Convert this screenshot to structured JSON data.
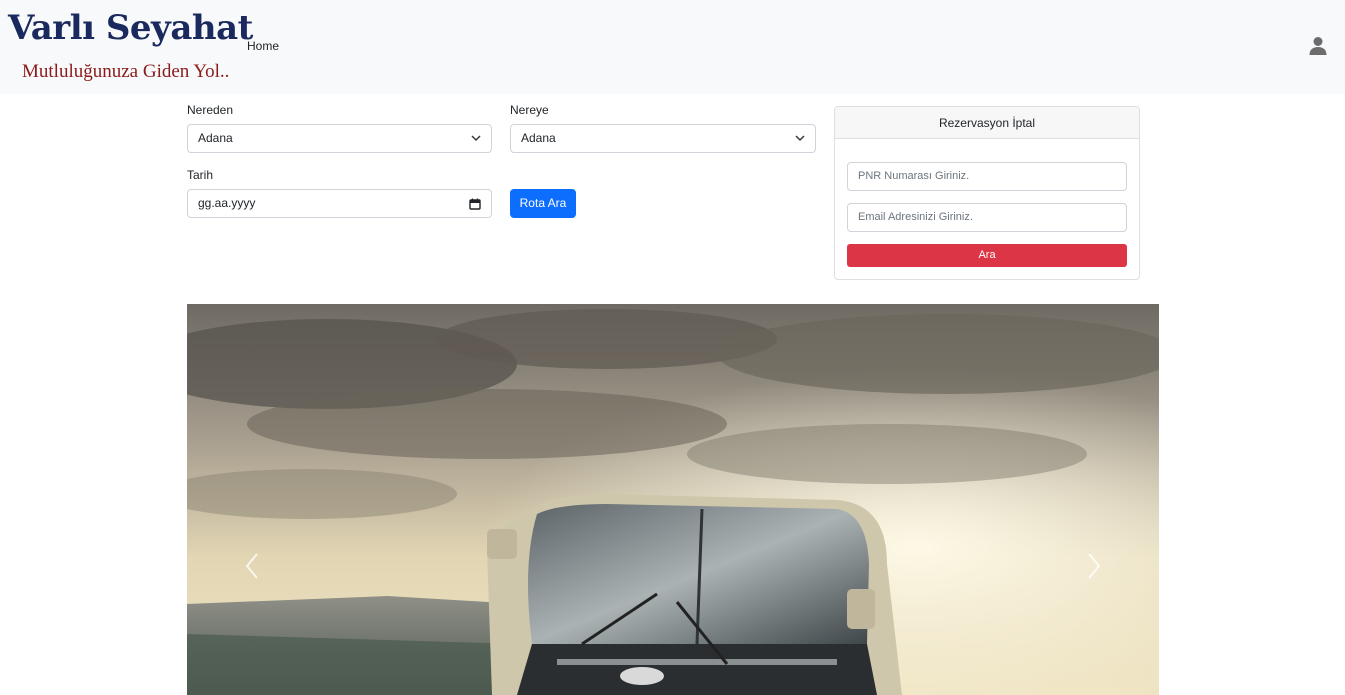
{
  "navbar": {
    "brand_title": "Varlı Seyahat",
    "brand_slogan": "Mutluluğunuza Giden Yol..",
    "home_link": "Home",
    "user_icon": "user-icon"
  },
  "search": {
    "from_label": "Nereden",
    "from_value": "Adana",
    "to_label": "Nereye",
    "to_value": "Adana",
    "date_label": "Tarih",
    "date_placeholder": "gg.aa.yyyy",
    "search_button": "Rota Ara"
  },
  "cancel_card": {
    "title": "Rezervasyon İptal",
    "pnr_placeholder": "PNR Numarası Giriniz.",
    "email_placeholder": "Email Adresinizi Giriniz.",
    "submit_button": "Ara"
  },
  "colors": {
    "brand": "#1b2a5e",
    "slogan": "#8b1a1a",
    "primary": "#0d6efd",
    "danger": "#dc3545"
  }
}
